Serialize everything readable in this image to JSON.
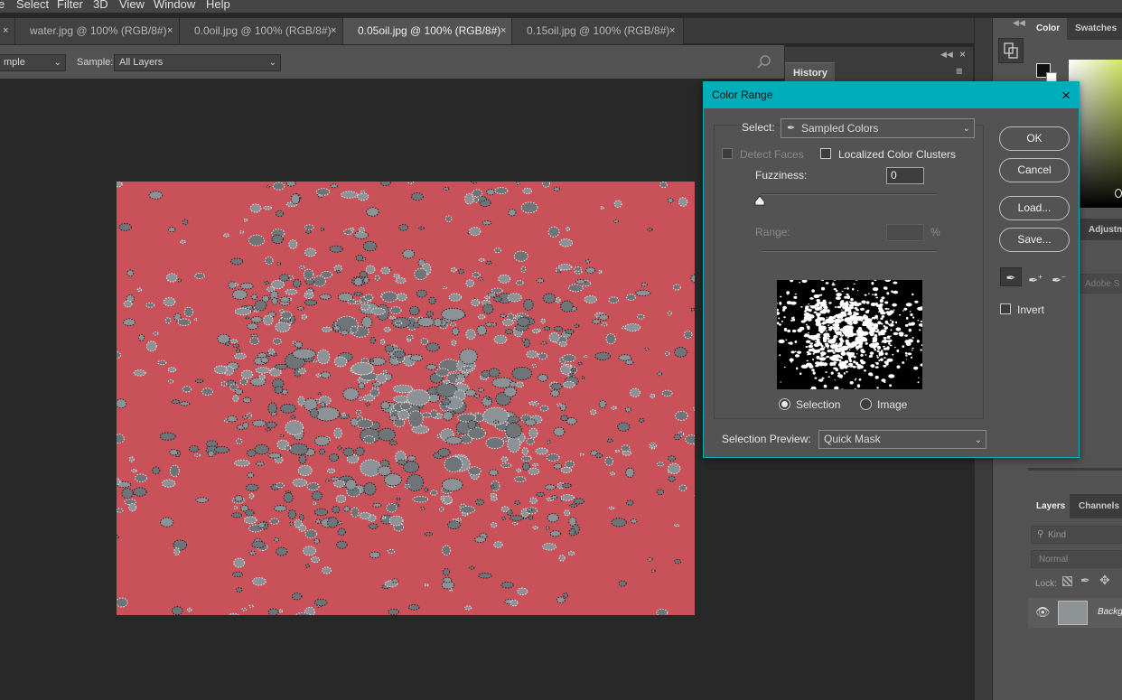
{
  "menu": [
    "e",
    "Select",
    "Filter",
    "3D",
    "View",
    "Window",
    "Help"
  ],
  "tabs": [
    {
      "label": "water.jpg @ 100% (RGB/8#)",
      "active": false
    },
    {
      "label": "0.0oil.jpg @ 100% (RGB/8#)",
      "active": false
    },
    {
      "label": "0.05oil.jpg @ 100% (RGB/8#)",
      "active": true
    },
    {
      "label": "0.15oil.jpg @ 100% (RGB/8#)",
      "active": false
    }
  ],
  "tab_close": "×",
  "options": {
    "sample_size_value": "mple",
    "sample_label": "Sample:",
    "sample_value": "All Layers"
  },
  "history": {
    "title": "History"
  },
  "right_panel": {
    "color_tab": "Color",
    "swatches_tab": "Swatches",
    "adjust_tab": "Adjustm",
    "adobe_stock": "Adobe S",
    "layers_tab": "Layers",
    "channels_tab": "Channels",
    "kind": "Kind",
    "blend_mode": "Normal",
    "lock_label": "Lock:",
    "layer_name": "Backgr"
  },
  "dialog": {
    "title": "Color Range",
    "select_label": "Select:",
    "select_value": "Sampled Colors",
    "detect_faces": "Detect Faces",
    "localized": "Localized Color Clusters",
    "fuzziness_label": "Fuzziness:",
    "fuzziness_value": "0",
    "range_label": "Range:",
    "range_unit": "%",
    "selection_label": "Selection",
    "image_label": "Image",
    "preview_label": "Selection Preview:",
    "preview_value": "Quick Mask",
    "ok": "OK",
    "cancel": "Cancel",
    "load": "Load...",
    "save": "Save...",
    "invert": "Invert",
    "close": "×"
  },
  "colors": {
    "accent": "#00aebb",
    "mask_red": "#c9525a",
    "panel": "#535353",
    "canvas_bg": "#282828"
  },
  "icons": [
    "close-icon",
    "search-icon",
    "eyedropper-icon",
    "eyedropper-plus-icon",
    "eyedropper-minus-icon",
    "eye-icon",
    "lock-pixels-icon",
    "brush-icon",
    "move-icon",
    "collapse-icon",
    "panel-menu-icon"
  ]
}
